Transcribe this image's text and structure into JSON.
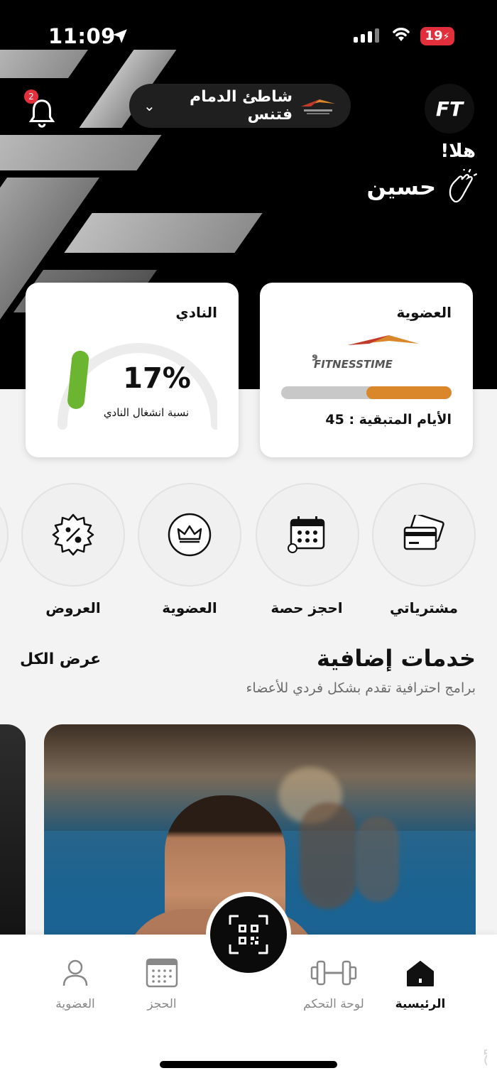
{
  "status_bar": {
    "time": "11:09",
    "battery": "19"
  },
  "header": {
    "notification_count": "2",
    "branch": "شاطئ الدمام فتنس",
    "logo": "FT"
  },
  "greeting": {
    "hello": "هلا!",
    "name": "حسين"
  },
  "membership_card": {
    "title": "العضوية",
    "logo_text": "وقت اللياقة FITNESSTIME",
    "remaining_label": "الأيام المتبقية : 45",
    "progress": 0.5
  },
  "club_card": {
    "title": "النادي",
    "occupancy": "17%",
    "occupancy_value": 17,
    "occupancy_label": "نسبة انشغال النادي"
  },
  "services": [
    {
      "label": "مشترياتي",
      "icon": "card-icon"
    },
    {
      "label": "احجز حصة",
      "icon": "calendar-icon"
    },
    {
      "label": "العضوية",
      "icon": "crown-icon"
    },
    {
      "label": "العروض",
      "icon": "discount-icon"
    }
  ],
  "extra_services": {
    "title": "خدمات إضافية",
    "subtitle": "برامج احترافية تقدم بشكل فردي للأعضاء",
    "view_all": "عرض الكل"
  },
  "tabs": [
    {
      "label": "الرئيسية",
      "icon": "home-icon",
      "active": true
    },
    {
      "label": "لوحة التحكم",
      "icon": "dumbbell-icon",
      "active": false
    },
    {
      "label": "الحجز",
      "icon": "calendar-icon",
      "active": false
    },
    {
      "label": "العضوية",
      "icon": "user-icon",
      "active": false
    }
  ],
  "colors": {
    "accent": "#d9872a",
    "green": "#6cb531",
    "badge": "#e1303c"
  },
  "watermark": "حراج"
}
